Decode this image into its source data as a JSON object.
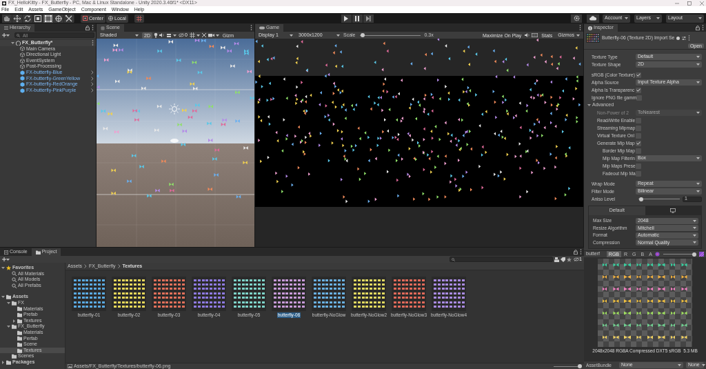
{
  "window": {
    "title": "FX_HelloKitty - FX_Butterfly - PC, Mac & Linux Standalone - Unity 2020.3.46f1* <DX11>"
  },
  "menu": [
    "File",
    "Edit",
    "Assets",
    "GameObject",
    "Component",
    "Window",
    "Help"
  ],
  "toolbar": {
    "tools": [
      {
        "kind": "hand",
        "selected": false
      },
      {
        "kind": "move",
        "selected": false
      },
      {
        "kind": "rotate",
        "selected": false
      },
      {
        "kind": "scale",
        "selected": false
      },
      {
        "kind": "rect",
        "selected": true
      },
      {
        "kind": "transform",
        "selected": false
      },
      {
        "kind": "custom",
        "selected": false
      }
    ],
    "pivot": [
      "Center",
      "Local"
    ],
    "account": "Account",
    "layers": "Layers",
    "layout": "Layout"
  },
  "hierarchy": {
    "title": "Hierarchy",
    "search_placeholder": "All",
    "root": {
      "name": "FX_Butterfly*",
      "expanded": true,
      "children": [
        {
          "name": "Main Camera",
          "kind": "gameobject"
        },
        {
          "name": "Directional Light",
          "kind": "gameobject"
        },
        {
          "name": "EventSystem",
          "kind": "gameobject"
        },
        {
          "name": "Post-Processing",
          "kind": "gameobject"
        },
        {
          "name": "FX-butterfly-Blue",
          "kind": "prefab"
        },
        {
          "name": "FX-butterfly-GreenYellow",
          "kind": "prefab"
        },
        {
          "name": "FX-butterfly-RedOrange",
          "kind": "prefab"
        },
        {
          "name": "FX-butterfly-PinkPurple",
          "kind": "prefab"
        }
      ]
    }
  },
  "scene": {
    "title": "Scene",
    "shading": "Shaded",
    "mode": "2D",
    "hidden_count": "0",
    "gizmos": "Gizm"
  },
  "game": {
    "title": "Game",
    "display": "Display 1",
    "resolution": "3000x1200",
    "scale_label": "Scale",
    "scale": {
      "level": 0.05
    },
    "scale_value": "0.3x",
    "maximize": "Maximize On Play",
    "stats": "Stats",
    "gizmos": "Gizmos"
  },
  "inspector": {
    "title": "Inspector",
    "asset_title": "Butterfly-06 (Texture 2D) Import Se",
    "open": "Open",
    "fields": [
      {
        "kind": "dropdown",
        "label": "Texture Type",
        "value": "Default",
        "disabled": false
      },
      {
        "kind": "dropdown",
        "label": "Texture Shape",
        "value": "2D",
        "disabled": false
      },
      {
        "kind": "gap"
      },
      {
        "kind": "checkbox",
        "label": "sRGB (Color Texture)",
        "checked": true
      },
      {
        "kind": "dropdown",
        "label": "Alpha Source",
        "value": "Input Texture Alpha",
        "disabled": false
      },
      {
        "kind": "checkbox",
        "label": "Alpha Is Transparenc",
        "checked": true
      },
      {
        "kind": "checkbox",
        "label": "Ignore PNG file gamm",
        "checked": false
      },
      {
        "kind": "foldout",
        "label": "Advanced",
        "expanded": true,
        "children": [
          {
            "kind": "dropdown",
            "label": "Non-Power of 2",
            "value": "ToNearest",
            "disabled": true
          },
          {
            "kind": "checkbox",
            "label": "Read/Write Enable",
            "checked": false
          },
          {
            "kind": "checkbox",
            "label": "Streaming Mipmap",
            "checked": false
          },
          {
            "kind": "checkbox",
            "label": "Virtual Texture Onl",
            "checked": false
          },
          {
            "kind": "checkbox",
            "label": "Generate Mip Map",
            "checked": true,
            "children": [
              {
                "kind": "checkbox",
                "label": "Border Mip Map",
                "checked": false
              },
              {
                "kind": "dropdown",
                "label": "Mip Map Filterin",
                "value": "Box",
                "disabled": false
              },
              {
                "kind": "checkbox",
                "label": "Mip Maps Prese",
                "checked": false
              },
              {
                "kind": "checkbox",
                "label": "Fadeout Mip Ma",
                "checked": false
              }
            ]
          }
        ]
      },
      {
        "kind": "gap"
      },
      {
        "kind": "dropdown",
        "label": "Wrap Mode",
        "value": "Repeat",
        "disabled": false
      },
      {
        "kind": "dropdown",
        "label": "Filter Mode",
        "value": "Bilinear",
        "disabled": false
      },
      {
        "kind": "slider",
        "label": "Aniso Level",
        "level": 0.06,
        "value": "1"
      }
    ],
    "platform_tabs": [
      {
        "label": "Default",
        "selected": true
      },
      {
        "selected": false
      }
    ],
    "platform_fields": [
      {
        "label": "Max Size",
        "value": "2048"
      },
      {
        "label": "Resize Algorithm",
        "value": "Mitchell"
      },
      {
        "label": "Format",
        "value": "Automatic"
      },
      {
        "label": "Compression",
        "value": "Normal Quality"
      }
    ],
    "preview": {
      "name": "butterf",
      "channels": [
        {
          "label": "RGB",
          "selected": true
        },
        {
          "label": "R",
          "selected": false
        },
        {
          "label": "G",
          "selected": false
        },
        {
          "label": "B",
          "selected": false
        },
        {
          "label": "A",
          "selected": false
        }
      ],
      "mip": {
        "level": 0.95
      },
      "info": "2048x2048 RGBA Compressed DXT5 sRGB  5.3 MB"
    },
    "asset_bundle": {
      "label": "AssetBundle",
      "value": "None",
      "variant": "None"
    }
  },
  "project": {
    "tabs": [
      {
        "label": "Console",
        "selected": false
      },
      {
        "label": "Project",
        "selected": true
      }
    ],
    "hidden_count": "1",
    "favorites": {
      "name": "Favorites",
      "kind": "favorites",
      "expanded": true,
      "selected": false,
      "children": [
        {
          "name": "All Materials",
          "kind": "search",
          "selected": false
        },
        {
          "name": "All Models",
          "kind": "search",
          "selected": false
        },
        {
          "name": "All Prefabs",
          "kind": "search",
          "selected": false
        }
      ]
    },
    "tree": [
      {
        "name": "Assets",
        "kind": "folder",
        "expanded": true,
        "selected": false,
        "children": [
          {
            "name": "FX",
            "kind": "folder",
            "expanded": true,
            "selected": false,
            "children": [
              {
                "name": "Materials",
                "kind": "folder",
                "selected": false
              },
              {
                "name": "Prefab",
                "kind": "folder",
                "selected": false
              },
              {
                "name": "Textures",
                "kind": "folder",
                "expanded": false,
                "selected": false
              }
            ]
          },
          {
            "name": "FX_Butterfly",
            "kind": "folder",
            "expanded": true,
            "selected": false,
            "children": [
              {
                "name": "Materials",
                "kind": "folder",
                "selected": false
              },
              {
                "name": "Perfab",
                "kind": "folder",
                "selected": false
              },
              {
                "name": "Scene",
                "kind": "folder",
                "selected": false
              },
              {
                "name": "Textures",
                "kind": "folder",
                "selected": true
              }
            ]
          },
          {
            "name": "Scenes",
            "kind": "folder",
            "selected": false
          }
        ]
      },
      {
        "name": "Packages",
        "kind": "folder",
        "expanded": false,
        "selected": false
      }
    ],
    "breadcrumb": [
      "Assets",
      "FX_Butterfly",
      "Textures"
    ],
    "items": [
      {
        "name": "butterfly-01",
        "color": "#5aa9e0",
        "selected": false
      },
      {
        "name": "butterfly-02",
        "color": "#e5d65a",
        "selected": false
      },
      {
        "name": "butterfly-03",
        "color": "#e0705a",
        "selected": false
      },
      {
        "name": "butterfly-04",
        "color": "#8e7ae0",
        "selected": false
      },
      {
        "name": "butterfly-05",
        "color": "#7ed3c8",
        "selected": false
      },
      {
        "name": "butterfly-06",
        "color": "#c79ad8",
        "selected": true
      },
      {
        "name": "butterfly-NoGlow",
        "color": "#6ab0e0",
        "selected": false
      },
      {
        "name": "butterfly-NoGlow2",
        "color": "#e0d860",
        "selected": false
      },
      {
        "name": "butterfly-NoGlow3",
        "color": "#e06a5a",
        "selected": false
      },
      {
        "name": "butterfly-NoGlow4",
        "color": "#a88ae0",
        "selected": false
      }
    ],
    "path": "Assets/FX_Butterfly/Textures/butterfly-06.png",
    "thumbnail_size": {
      "level": 0.95
    }
  }
}
